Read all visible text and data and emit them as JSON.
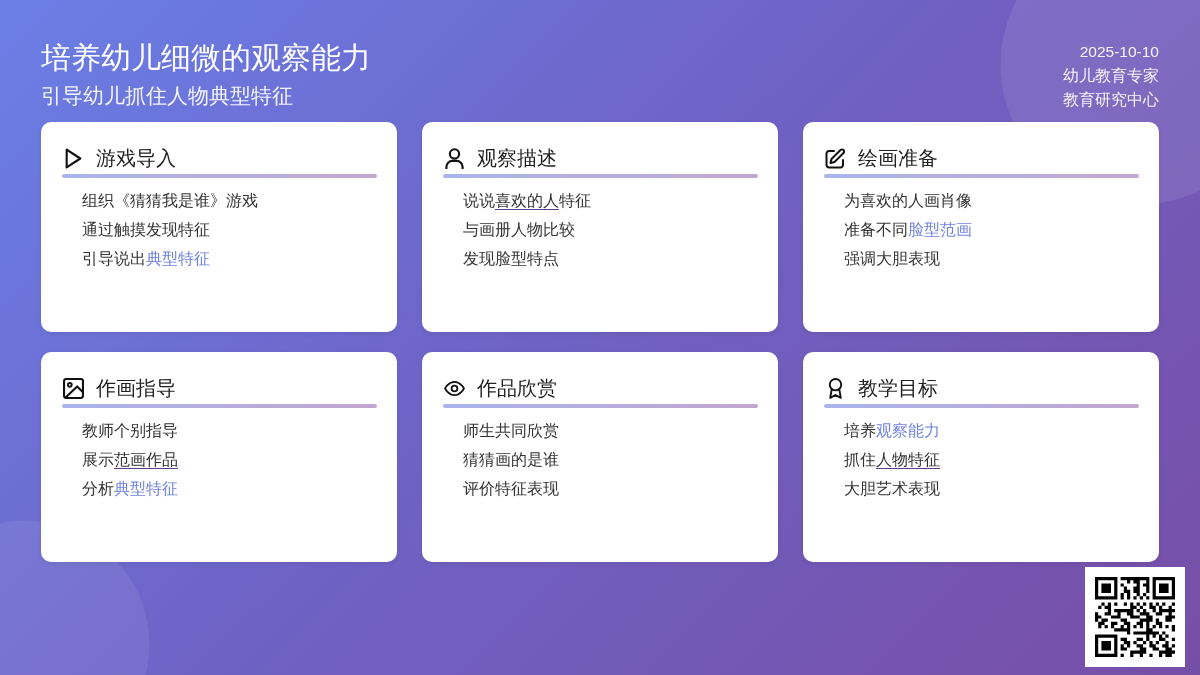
{
  "header": {
    "title": "培养幼儿细微的观察能力",
    "subtitle": "引导幼儿抓住人物典型特征",
    "date": "2025-10-10",
    "author": "幼儿教育专家",
    "organization": "教育研究中心"
  },
  "cards": [
    {
      "title": "游戏导入",
      "items": [
        {
          "parts": [
            {
              "text": "组织《猜猜我是谁》游戏",
              "kind": "plain"
            }
          ]
        },
        {
          "parts": [
            {
              "text": "通过触摸发现特征",
              "kind": "plain"
            }
          ]
        },
        {
          "parts": [
            {
              "text": "引导说出",
              "kind": "plain"
            },
            {
              "text": "典型特征",
              "kind": "accent"
            }
          ]
        }
      ]
    },
    {
      "title": "观察描述",
      "items": [
        {
          "parts": [
            {
              "text": "说说",
              "kind": "plain"
            },
            {
              "text": "喜欢的人",
              "kind": "underline"
            },
            {
              "text": "特征",
              "kind": "plain"
            }
          ]
        },
        {
          "parts": [
            {
              "text": "与画册人物比较",
              "kind": "plain"
            }
          ]
        },
        {
          "parts": [
            {
              "text": "发现脸型特点",
              "kind": "plain"
            }
          ]
        }
      ]
    },
    {
      "title": "绘画准备",
      "items": [
        {
          "parts": [
            {
              "text": "为喜欢的人画肖像",
              "kind": "plain"
            }
          ]
        },
        {
          "parts": [
            {
              "text": "准备不同",
              "kind": "plain"
            },
            {
              "text": "脸型范画",
              "kind": "accent"
            }
          ]
        },
        {
          "parts": [
            {
              "text": "强调大胆表现",
              "kind": "plain"
            }
          ]
        }
      ]
    },
    {
      "title": "作画指导",
      "items": [
        {
          "parts": [
            {
              "text": "教师个别指导",
              "kind": "plain"
            }
          ]
        },
        {
          "parts": [
            {
              "text": "展示",
              "kind": "plain"
            },
            {
              "text": "范画作品",
              "kind": "underline"
            }
          ]
        },
        {
          "parts": [
            {
              "text": "分析",
              "kind": "plain"
            },
            {
              "text": "典型特征",
              "kind": "accent"
            }
          ]
        }
      ]
    },
    {
      "title": "作品欣赏",
      "items": [
        {
          "parts": [
            {
              "text": "师生共同欣赏",
              "kind": "plain"
            }
          ]
        },
        {
          "parts": [
            {
              "text": "猜猜画的是谁",
              "kind": "plain"
            }
          ]
        },
        {
          "parts": [
            {
              "text": "评价特征表现",
              "kind": "plain"
            }
          ]
        }
      ]
    },
    {
      "title": "教学目标",
      "items": [
        {
          "parts": [
            {
              "text": "培养",
              "kind": "plain"
            },
            {
              "text": "观察能力",
              "kind": "accent"
            }
          ]
        },
        {
          "parts": [
            {
              "text": "抓住",
              "kind": "plain"
            },
            {
              "text": "人物特征",
              "kind": "underline"
            }
          ]
        },
        {
          "parts": [
            {
              "text": "大胆艺术表现",
              "kind": "plain"
            }
          ]
        }
      ]
    }
  ]
}
